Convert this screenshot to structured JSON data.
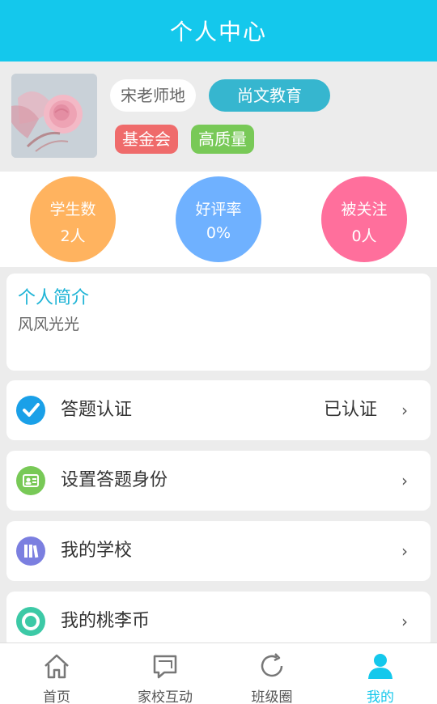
{
  "header": {
    "title": "个人中心"
  },
  "profile": {
    "name": "宋老师地",
    "organization": "尚文教育",
    "tags": [
      "基金会",
      "高质量"
    ]
  },
  "stats": [
    {
      "label": "学生数",
      "value": "2人",
      "color": "#ffb35f"
    },
    {
      "label": "好评率",
      "value": "0%",
      "color": "#6fb1ff"
    },
    {
      "label": "被关注",
      "value": "0人",
      "color": "#ff6f9c"
    }
  ],
  "intro": {
    "title": "个人简介",
    "text": "风风光光"
  },
  "menu": [
    {
      "label": "答题认证",
      "value": "已认证",
      "icon": "check-circle-icon",
      "color": "#1aa0e8"
    },
    {
      "label": "设置答题身份",
      "value": "",
      "icon": "id-card-icon",
      "color": "#78c957"
    },
    {
      "label": "我的学校",
      "value": "",
      "icon": "books-icon",
      "color": "#7b7fe0"
    },
    {
      "label": "我的桃李币",
      "value": "",
      "icon": "coin-ring-icon",
      "color": "#3cc9a6"
    }
  ],
  "chevron": "›",
  "tabs": [
    {
      "label": "首页",
      "icon": "home-icon"
    },
    {
      "label": "家校互动",
      "icon": "chat-icon"
    },
    {
      "label": "班级圈",
      "icon": "refresh-icon"
    },
    {
      "label": "我的",
      "icon": "person-icon",
      "active": true
    }
  ],
  "colors": {
    "accent": "#14c8ec",
    "org_tag": "#36b6cf",
    "tag_red": "#ef6b6b",
    "tag_green": "#78c957"
  }
}
